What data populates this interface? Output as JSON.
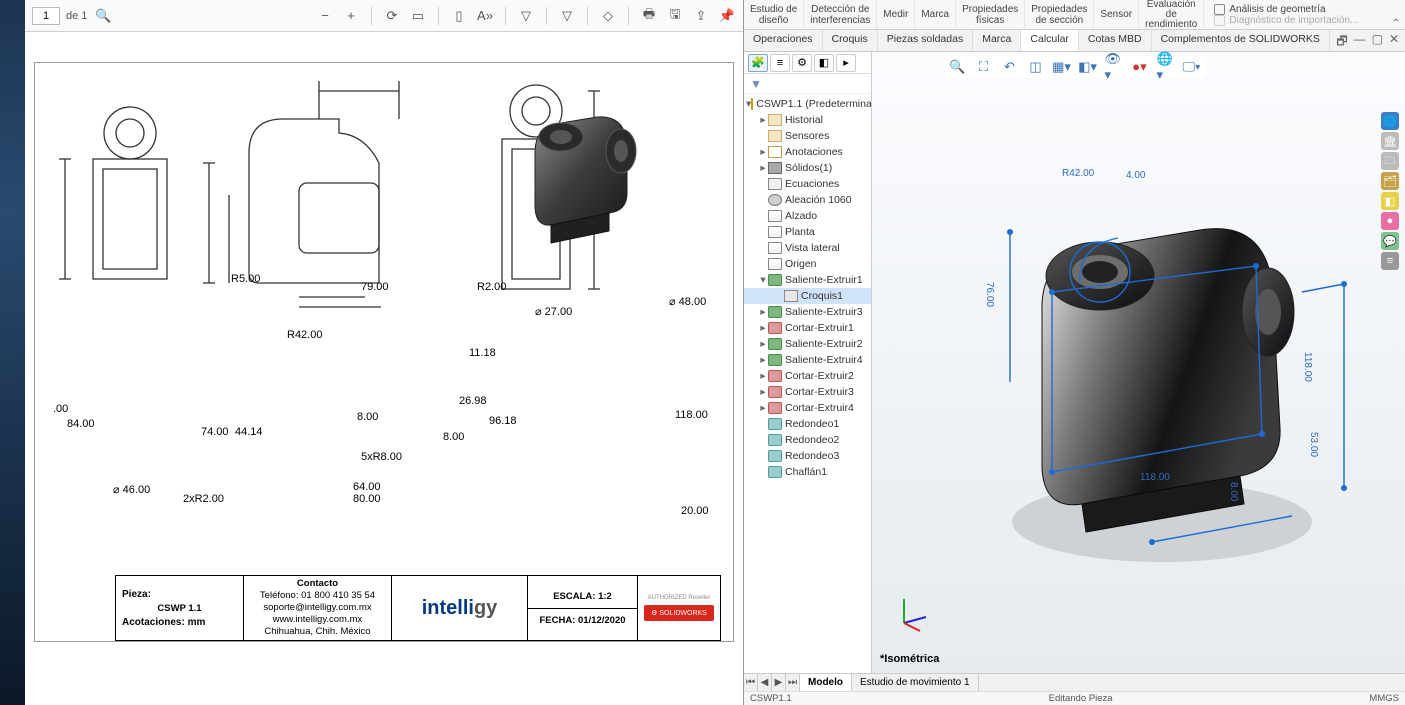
{
  "pdf": {
    "page_current": "1",
    "page_label": "de 1",
    "dimensions": {
      "r5": "R5.00",
      "d79": "79.00",
      "r2": "R2.00",
      "r42": "R42.00",
      "d11_18": "11.18",
      "d8a": "8.00",
      "d26_98": "26.98",
      "d8b": "8.00",
      "d96_18": "96.18",
      "d5xR8": "5xR8.00",
      "d64": "64.00",
      "d80": "80.00",
      "d84": "84.00",
      "d46": "⌀ 46.00",
      "d2xR2": "2xR2.00",
      "d74": "74.00",
      "d44_14": "44.14",
      "d27": "⌀ 27.00",
      "d48": "⌀ 48.00",
      "d118": "118.00",
      "d20": "20.00",
      "unk": ".00"
    },
    "titleblock": {
      "pieza_label": "Pieza:",
      "pieza_value": "CSWP 1.1",
      "acot_label": "Acotaciones: mm",
      "contacto_h": "Contacto",
      "tel": "Teléfono: 01 800 410 35 54",
      "mail": "soporte@intelligy.com.mx",
      "web": "www.intelligy.com.mx",
      "city": "Chihuahua, Chih. México",
      "logo1": "intelli",
      "logo2": "gy",
      "escala": "ESCALA: 1:2",
      "fecha": "FECHA: 01/12/2020",
      "auth": "AUTHORIZED Reseller",
      "swmark": "SOLIDWORKS"
    }
  },
  "sw": {
    "ribbon": {
      "g1a": "Estudio de",
      "g1b": "diseño",
      "g2a": "Detección de",
      "g2b": "interferencias",
      "g3": "Medir",
      "g4": "Marca",
      "g5a": "Propiedades",
      "g5b": "físicas",
      "g6a": "Propiedades",
      "g6b": "de sección",
      "g7": "Sensor",
      "g8a": "Evaluación",
      "g8b": "de",
      "g8c": "rendimiento",
      "chk1": "Análisis de geometría",
      "chk2": "Diagnóstico de importación..."
    },
    "tabs": {
      "t1": "Operaciones",
      "t2": "Croquis",
      "t3": "Piezas soldadas",
      "t4": "Marca",
      "t5": "Calcular",
      "t6": "Cotas MBD",
      "t7": "Complementos de SOLIDWORKS"
    },
    "tree": {
      "root": "CSWP1.1 (Predeterminado)",
      "hist": "Historial",
      "sens": "Sensores",
      "anot": "Anotaciones",
      "sol": "Sólidos(1)",
      "ecu": "Ecuaciones",
      "mat": "Aleación 1060",
      "alz": "Alzado",
      "pla": "Planta",
      "vla": "Vista lateral",
      "ori": "Origen",
      "f1": "Saliente-Extruir1",
      "sk1": "Croquis1",
      "f2": "Saliente-Extruir3",
      "f3": "Cortar-Extruir1",
      "f4": "Saliente-Extruir2",
      "f5": "Saliente-Extruir4",
      "f6": "Cortar-Extruir2",
      "f7": "Cortar-Extruir3",
      "f8": "Cortar-Extruir4",
      "r1": "Redondeo1",
      "r2": "Redondeo2",
      "r3": "Redondeo3",
      "ch": "Chaflán1"
    },
    "gfx": {
      "viewname": "*Isométrica",
      "d_r42": "R42.00",
      "d_118": "118.00",
      "d_118b": "118.00",
      "d_76": "76.00",
      "d_8": "8.00",
      "d_53": "53.00",
      "d_4": "4.00"
    },
    "bottom": {
      "model": "Modelo",
      "motion": "Estudio de movimiento 1"
    },
    "status": {
      "file": "CSWP1.1",
      "edit": "Editando Pieza",
      "units": "MMGS"
    }
  }
}
